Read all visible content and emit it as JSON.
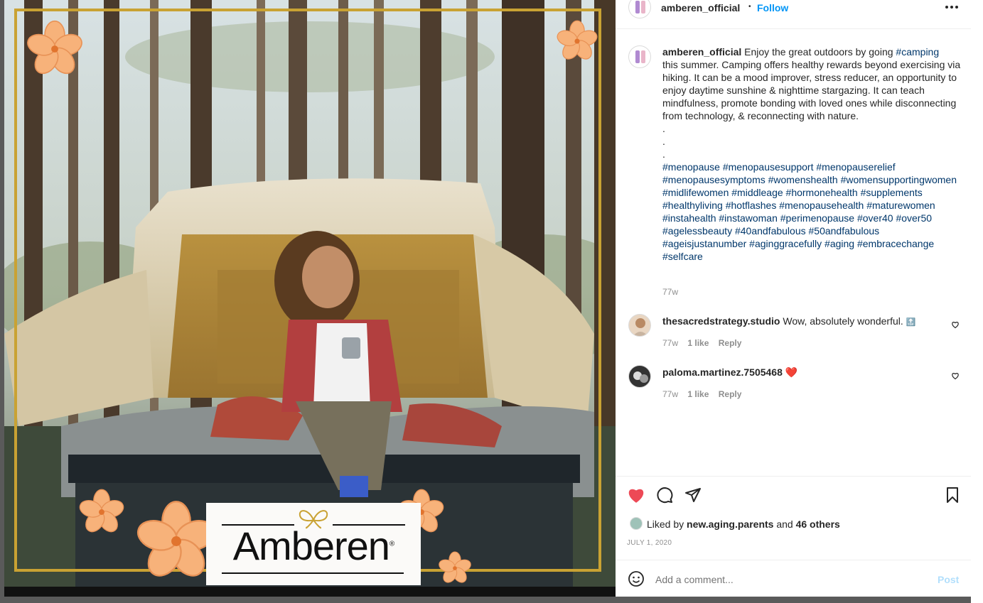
{
  "post": {
    "image_alt": "Woman with curly hair sitting on a rooftop tent in a forest holding a mug",
    "logo_text": "Amberen",
    "logo_mark": "®"
  },
  "header": {
    "username": "amberen_official",
    "separator": "•",
    "follow_label": "Follow"
  },
  "caption": {
    "username": "amberen_official",
    "text_before": " Enjoy the great outdoors by going ",
    "tag_camping": "#camping",
    "text_after": "\nthis summer. Camping offers healthy rewards beyond exercising via hiking. It can be a mood improver, stress reducer, an opportunity to enjoy daytime sunshine & nighttime stargazing. It can teach mindfulness, promote bonding with loved ones while disconnecting from technology, & reconnecting with nature.\n.\n.\n.",
    "hashtags": "#menopause #menopausesupport #menopauserelief #menopausesymptoms #womenshealth #womensupportingwomen #midlifewomen #middleage #hormonehealth #supplements #healthyliving #hotflashes #menopausehealth #maturewomen #instahealth #instawoman #perimenopause #over40 #over50 #agelessbeauty #40andfabulous #50andfabulous #ageisjustanumber #aginggracefully #aging #embracechange #selfcare",
    "time": "77w"
  },
  "comments": [
    {
      "username": "thesacredstrategy.studio",
      "text": "Wow, absolutely wonderful.",
      "emoji": "🔝",
      "time": "77w",
      "likes": "1 like",
      "reply": "Reply"
    },
    {
      "username": "paloma.martinez.7505468",
      "text": "",
      "emoji": "❤️",
      "time": "77w",
      "likes": "1 like",
      "reply": "Reply"
    }
  ],
  "likes": {
    "prefix": "Liked by ",
    "liker": "new.aging.parents",
    "mid": " and ",
    "others": "46 others"
  },
  "date": "JULY 1, 2020",
  "add_comment": {
    "placeholder": "Add a comment...",
    "post_label": "Post"
  },
  "colors": {
    "like_active": "#ed4956",
    "link": "#00376b",
    "follow": "#0095f6",
    "frame_gold": "#c9a233",
    "flower": "#f7b27a"
  }
}
